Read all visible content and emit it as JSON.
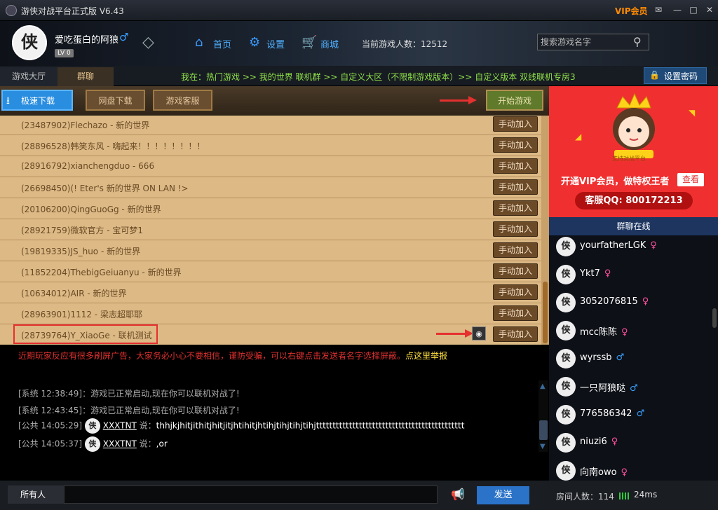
{
  "window": {
    "title": "游侠对战平台正式版 V6.43",
    "vip_label": "VIP会员",
    "buttons": [
      "✉",
      "—",
      "□",
      "✕"
    ]
  },
  "user": {
    "name": "爱吃蛋白的阿狼",
    "level": "LV 0",
    "avatar_char": "侠"
  },
  "nav": [
    {
      "label": "首页",
      "icon": "home-icon"
    },
    {
      "label": "设置",
      "icon": "gear-icon"
    },
    {
      "label": "商城",
      "icon": "cart-icon"
    }
  ],
  "online": {
    "label": "当前游戏人数：12512"
  },
  "search": {
    "placeholder": "搜索游戏名字"
  },
  "tabs": [
    {
      "label": "游戏大厅"
    },
    {
      "label": "群聊"
    }
  ],
  "breadcrumb": "我在：热门游戏 >> 我的世界 联机群 >> 自定义大区（不限制游戏版本）>> 自定义版本 双线联机专房3",
  "set_password": "设置密码",
  "toolbar": {
    "fast_download": "极速下载",
    "pan_download": "网盘下载",
    "game_service": "游戏客服",
    "start_game": "开始游戏"
  },
  "rooms": {
    "join_label": "手动加入",
    "items": [
      "(23487902)Flechazo - 新的世界",
      "(28896528)韩笑东风 - 嗨起来！！！！！！！！",
      "(28916792)xianchengduo - 666",
      "(26698450)(! Eter's 新的世界 ON LAN !>",
      "(20106200)QingGuoGg - 新的世界",
      "(28921759)微软官方 - 宝可梦1",
      "(19819335)JS_huo - 新的世界",
      "(11852204)ThebigGeiuanyu - 新的世界",
      "(10634012)AIR - 新的世界",
      "(28963901)1112 - 梁志超耶耶",
      "(28739764)Y_XiaoGe - 联机测试"
    ]
  },
  "chat": {
    "warning": "近期玩家反应有很多刷屏广告，大家务必小心不要相信，谨防受骗，可以右键点击发送者名字选择屏蔽。",
    "warning_link": "点这里举报",
    "messages": [
      {
        "prefix": "[系统 12:38:49]：",
        "body": "游戏已正常启动,现在你可以联机对战了!"
      },
      {
        "prefix": "[系统 12:43:45]：",
        "body": "游戏已正常启动,现在你可以联机对战了!"
      },
      {
        "prefix": "[公共 14:05:29]",
        "sender": "XXXTNT",
        "says": "说：",
        "body": "thhjkjhitjithitjhitjitjhtihitjhtihjtihjtihjtihjttttttttttttttttttttttttttttttttttttttttttttt"
      },
      {
        "prefix": "[公共 14:05:37]",
        "sender": "XXXTNT",
        "says": "说：",
        "body": ",or"
      }
    ],
    "recipient": "所有人",
    "send": "发送"
  },
  "vip_panel": {
    "badge": "支持对战平台",
    "text": "开通VIP会员，做特权王者",
    "view": "查看",
    "qq": "客服QQ: 800172213"
  },
  "members": {
    "header": "群聊在线",
    "items": [
      {
        "name": "yourfatherLGK",
        "gender": "♀"
      },
      {
        "name": "Ykt7",
        "gender": "♀"
      },
      {
        "name": "3052076815",
        "gender": "♀"
      },
      {
        "name": "mcc陈陈",
        "gender": "♀"
      },
      {
        "name": "wyrssb",
        "gender": "♂"
      },
      {
        "name": "一只阿狼哒",
        "gender": "♂"
      },
      {
        "name": "776586342",
        "gender": "♂"
      },
      {
        "name": "niuzi6",
        "gender": "♀"
      },
      {
        "name": "向南owo",
        "gender": "♀"
      }
    ]
  },
  "status": {
    "room_count": "房间人数：114",
    "ping": "24ms"
  },
  "colors": {
    "accent_blue": "#2a8ee0",
    "vip_red": "#f03030",
    "breadcrumb_green": "#8ee04a",
    "room_bg": "#dcb985"
  }
}
